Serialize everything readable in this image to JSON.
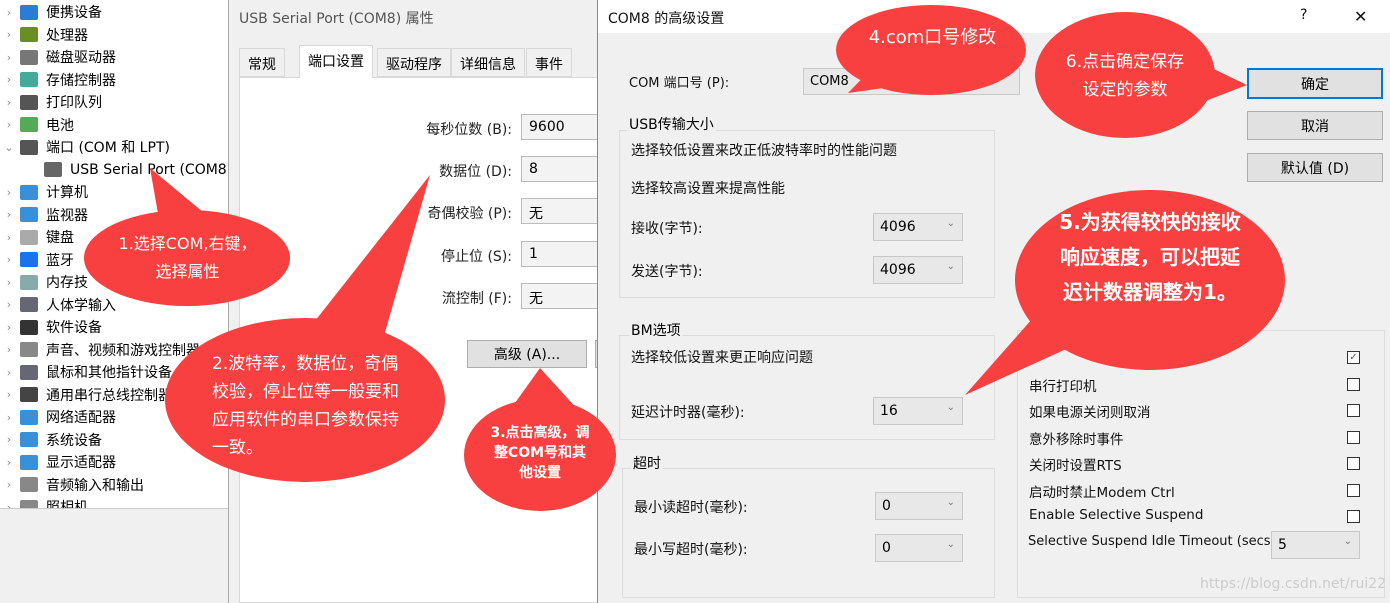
{
  "device_manager": {
    "items": [
      {
        "label": "便携设备",
        "icon": "portable-device-icon",
        "color": "#2b7cd3"
      },
      {
        "label": "处理器",
        "icon": "processor-icon",
        "color": "#6b8e23"
      },
      {
        "label": "磁盘驱动器",
        "icon": "disk-icon",
        "color": "#777"
      },
      {
        "label": "存储控制器",
        "icon": "storage-controller-icon",
        "color": "#4a9"
      },
      {
        "label": "打印队列",
        "icon": "printer-icon",
        "color": "#555"
      },
      {
        "label": "电池",
        "icon": "battery-icon",
        "color": "#5a5"
      },
      {
        "label": "端口 (COM 和 LPT)",
        "icon": "port-icon",
        "color": "#555",
        "expanded": true
      },
      {
        "label": "USB Serial Port (COM8)",
        "icon": "port-icon",
        "color": "#666",
        "child": true
      },
      {
        "label": "计算机",
        "icon": "computer-icon",
        "color": "#3a8fd9"
      },
      {
        "label": "监视器",
        "icon": "monitor-icon",
        "color": "#3a8fd9"
      },
      {
        "label": "键盘",
        "icon": "keyboard-icon",
        "color": "#aaa"
      },
      {
        "label": "蓝牙",
        "icon": "bluetooth-icon",
        "color": "#1a73e8"
      },
      {
        "label": "内存技",
        "icon": "memory-icon",
        "color": "#8aa"
      },
      {
        "label": "人体学输入",
        "icon": "hid-icon",
        "color": "#667"
      },
      {
        "label": "软件设备",
        "icon": "software-device-icon",
        "color": "#333"
      },
      {
        "label": "声音、视频和游戏控制器",
        "icon": "speaker-icon",
        "color": "#888"
      },
      {
        "label": "鼠标和其他指针设备",
        "icon": "mouse-icon",
        "color": "#667"
      },
      {
        "label": "通用串行总线控制器",
        "icon": "usb-icon",
        "color": "#444"
      },
      {
        "label": "网络适配器",
        "icon": "network-icon",
        "color": "#3a8fd9"
      },
      {
        "label": "系统设备",
        "icon": "system-device-icon",
        "color": "#3a8fd9"
      },
      {
        "label": "显示适配器",
        "icon": "display-adapter-icon",
        "color": "#3a8fd9"
      },
      {
        "label": "音频输入和输出",
        "icon": "speaker-icon",
        "color": "#888"
      },
      {
        "label": "照相机",
        "icon": "camera-icon",
        "color": "#888"
      }
    ]
  },
  "properties": {
    "title": "USB Serial Port (COM8) 属性",
    "tabs": [
      "常规",
      "端口设置",
      "驱动程序",
      "详细信息",
      "事件"
    ],
    "active_tab": "端口设置",
    "fields": [
      {
        "label": "每秒位数 (B):",
        "value": "9600"
      },
      {
        "label": "数据位 (D):",
        "value": "8"
      },
      {
        "label": "奇偶校验 (P):",
        "value": "无"
      },
      {
        "label": "停止位 (S):",
        "value": "1"
      },
      {
        "label": "流控制 (F):",
        "value": "无"
      }
    ],
    "advanced_button": "高级 (A)..."
  },
  "advanced": {
    "title": "COM8 的高级设置",
    "help": "?",
    "close": "✕",
    "com_port_label": "COM 端口号 (P):",
    "com_port_value": "COM8",
    "usb_group": "USB传输大小",
    "usb_text1": "选择较低设置来改正低波特率时的性能问题",
    "usb_text2": "选择较高设置来提高性能",
    "receive_label": "接收(字节):",
    "receive_value": "4096",
    "send_label": "发送(字节):",
    "send_value": "4096",
    "bm_group": "BM选项",
    "bm_text": "选择较低设置来更正响应问题",
    "latency_label": "延迟计时器(毫秒):",
    "latency_value": "16",
    "timeout_group": "超时",
    "read_timeout_label": "最小读超时(毫秒):",
    "read_timeout_value": "0",
    "write_timeout_label": "最小写超时(毫秒):",
    "write_timeout_value": "0",
    "options": [
      {
        "label": "",
        "checked": true
      },
      {
        "label": "串行打印机",
        "checked": false
      },
      {
        "label": "如果电源关闭则取消",
        "checked": false
      },
      {
        "label": "意外移除时事件",
        "checked": false
      },
      {
        "label": "关闭时设置RTS",
        "checked": false
      },
      {
        "label": "启动时禁止Modem Ctrl",
        "checked": false
      },
      {
        "label": "Enable Selective Suspend",
        "checked": false
      }
    ],
    "idle_timeout_label": "Selective Suspend Idle Timeout (secs):",
    "idle_timeout_value": "5",
    "ok": "确定",
    "cancel": "取消",
    "defaults": "默认值 (D)"
  },
  "callouts": {
    "c1": "1.选择COM,右键，选择属性",
    "c2": "2.波特率，数据位，奇偶校验，停止位等一般要和应用软件的串口参数保持一致。",
    "c3": "3.点击高级，调整COM号和其他设置",
    "c4": "4.com口号修改",
    "c5": "5.为获得较快的接收响应速度，可以把延迟计数器调整为1。",
    "c6": "6.点击确定保存设定的参数",
    "color": "#f84040"
  },
  "watermark": "https://blog.csdn.net/rui22"
}
